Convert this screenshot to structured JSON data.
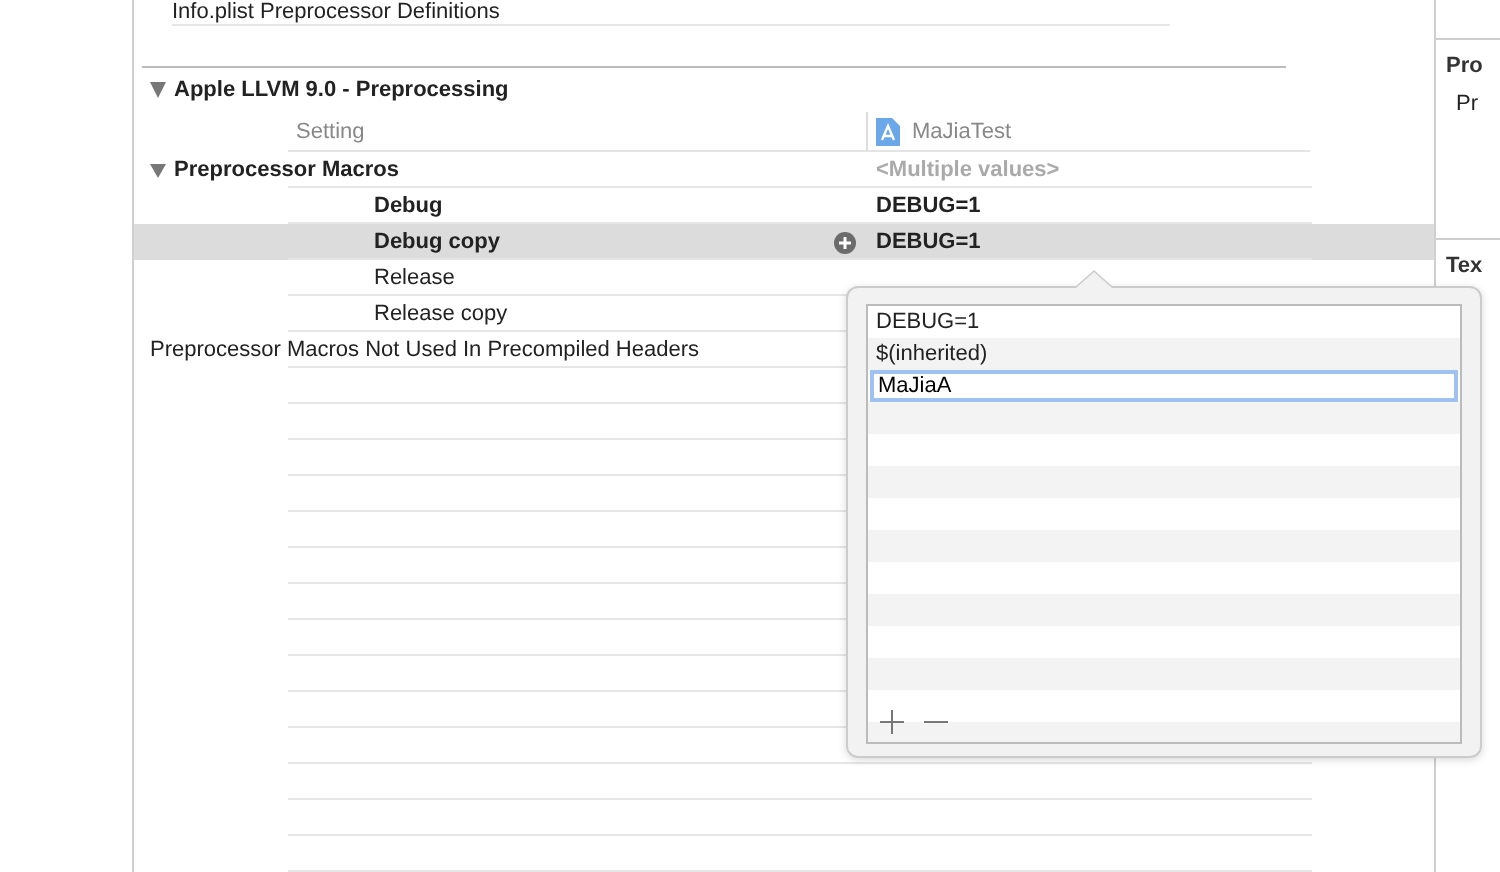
{
  "top_setting": {
    "label": "Info.plist Preprocessor Definitions"
  },
  "section": {
    "title": "Apple LLVM 9.0 - Preprocessing",
    "expanded": true,
    "header": {
      "setting": "Setting",
      "target": "MaJiaTest"
    },
    "settings": [
      {
        "label": "Preprocessor Macros",
        "expanded": true,
        "value": "<Multiple values>",
        "children": [
          {
            "label": "Debug",
            "value": "DEBUG=1",
            "modified": true,
            "selected": false
          },
          {
            "label": "Debug copy",
            "value": "DEBUG=1",
            "modified": true,
            "selected": true
          },
          {
            "label": "Release",
            "modified": false,
            "selected": false
          },
          {
            "label": "Release copy",
            "modified": false,
            "selected": false
          }
        ]
      },
      {
        "label": "Preprocessor Macros Not Used In Precompiled Headers"
      }
    ]
  },
  "popover": {
    "items": [
      {
        "text": "DEBUG=1",
        "editing": false
      },
      {
        "text": "$(inherited)",
        "editing": false
      },
      {
        "text": "MaJiaA",
        "editing": true
      }
    ]
  },
  "inspector": {
    "sections": [
      {
        "title": "Pro",
        "items": [
          "Pr"
        ]
      },
      {
        "title": "Tex"
      }
    ]
  }
}
